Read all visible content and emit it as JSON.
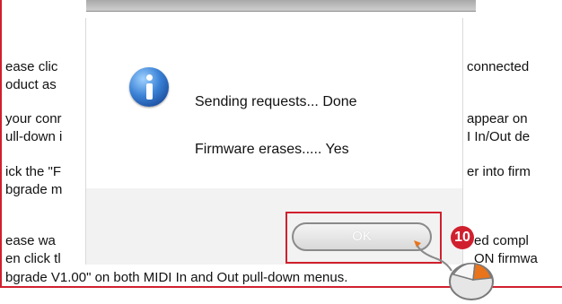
{
  "background_lines": [
    {
      "left": "ease clic",
      "right": "connected"
    },
    {
      "left": "oduct as",
      "right": ""
    },
    {
      "left": "your conr",
      "right": "appear on"
    },
    {
      "left": "ull-down i",
      "right": "I In/Out de"
    },
    {
      "left": "ick the \"F",
      "right": "er into firm"
    },
    {
      "left": "bgrade m",
      "right": ""
    },
    {
      "left": "ease wa",
      "right": "ed compl"
    },
    {
      "left": "en click tl",
      "right": "ON firmwa"
    },
    {
      "left": "bgrade V1.00\" on both MIDI In and Out pull-down menus.",
      "right": ""
    }
  ],
  "dialog": {
    "line1": "Sending requests... Done",
    "line2": "Firmware erases..... Yes",
    "ok_label": "OK"
  },
  "annotation": {
    "step_number": "10"
  },
  "colors": {
    "highlight": "#d0202e",
    "icon_blue": "#3b82d6"
  }
}
